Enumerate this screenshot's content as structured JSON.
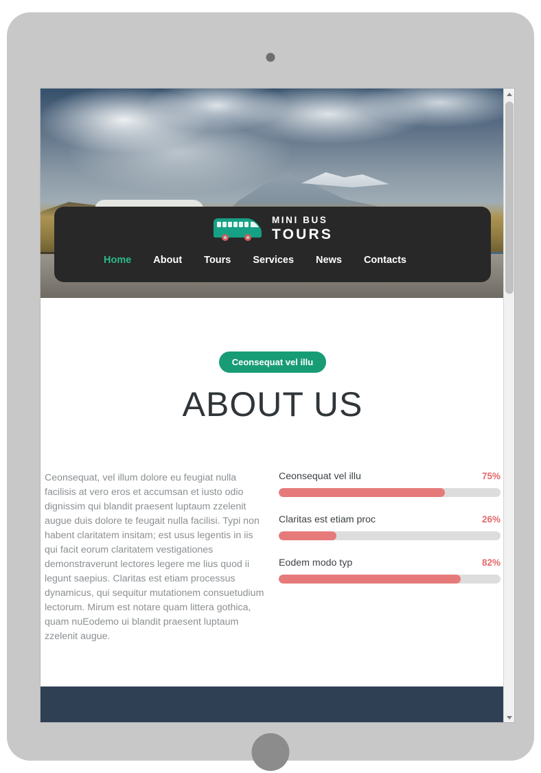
{
  "device": {
    "camera_icon": "camera-dot",
    "home_button_icon": "home-button"
  },
  "site": {
    "brand": {
      "logo_icon": "minibus-icon",
      "line1": "MINI BUS",
      "line2": "TOURS"
    },
    "nav": [
      {
        "label": "Home",
        "active": true
      },
      {
        "label": "About",
        "active": false
      },
      {
        "label": "Tours",
        "active": false
      },
      {
        "label": "Services",
        "active": false
      },
      {
        "label": "News",
        "active": false
      },
      {
        "label": "Contacts",
        "active": false
      }
    ],
    "hero": {
      "description": "green camper van on a mountain road with cloudy sky"
    }
  },
  "section": {
    "badge": "Ceonsequat vel illu",
    "title": "ABOUT US",
    "paragraph": "Ceonsequat, vel illum dolore eu feugiat nulla facilisis at vero eros et accumsan et iusto odio dignissim qui blandit praesent luptaum zzelenit augue duis dolore te feugait nulla facilisi. Typi non habent claritatem insitam; est usus legentis in iis qui facit eorum claritatem vestigationes demonstraverunt lectores legere me lius quod ii legunt saepius. Claritas est etiam processus dynamicus, qui sequitur mutationem consuetudium lectorum. Mirum est notare quam littera gothica, quam nuEodemo ui blandit praesent luptaum zzelenit augue.",
    "skills": [
      {
        "label": "Ceonsequat vel illu",
        "value": "75%",
        "percent": 75
      },
      {
        "label": "Claritas est etiam proc",
        "value": "26%",
        "percent": 26
      },
      {
        "label": "Eodem modo typ",
        "value": "82%",
        "percent": 82
      }
    ]
  },
  "colors": {
    "accent_teal": "#189c76",
    "nav_active": "#2bb98c",
    "progress_fill": "#e67a7a",
    "progress_track": "#dddddd",
    "percent_text": "#e2696c",
    "nav_card": "#282828",
    "footer": "#2f4055",
    "title": "#2f3538",
    "paragraph": "#8b8f92"
  },
  "scrollbar": {
    "up_icon": "scroll-up-arrow",
    "down_icon": "scroll-down-arrow"
  }
}
